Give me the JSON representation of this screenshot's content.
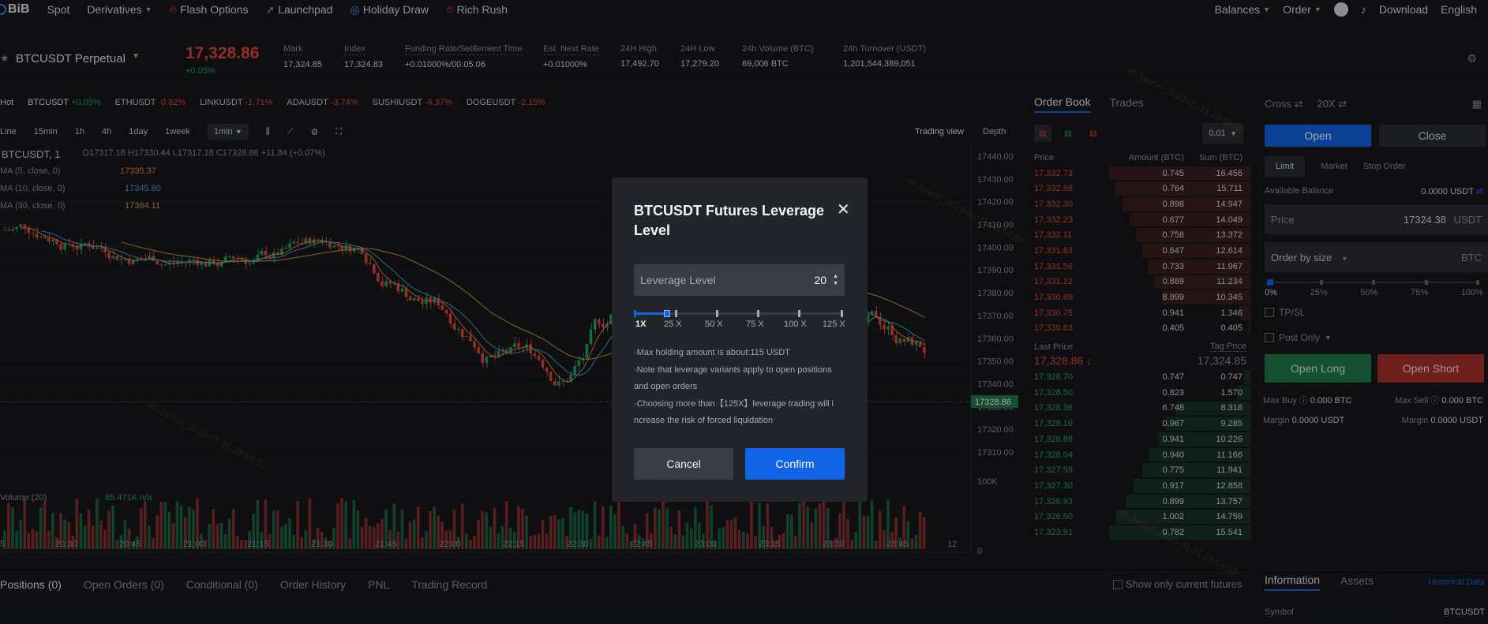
{
  "nav": {
    "logo": "BiB",
    "items": [
      {
        "label": "Spot"
      },
      {
        "label": "Derivatives"
      },
      {
        "label": "Flash Options"
      },
      {
        "label": "Launchpad"
      },
      {
        "label": "Holiday Draw"
      },
      {
        "label": "Rich Rush"
      }
    ],
    "right": {
      "balances": "Balances",
      "order": "Order",
      "download": "Download",
      "language": "English"
    }
  },
  "ticker": {
    "symbol": "BTCUSDT Perpetual",
    "price": "17,328.86",
    "change": "+0.05%",
    "stats": [
      {
        "label": "Mark",
        "value": "17,324.85"
      },
      {
        "label": "Index",
        "value": "17,324.83"
      },
      {
        "label": "Funding Rate/Settlement Time",
        "value": "+0.01000%/00:05:06"
      },
      {
        "label": "Est. Next Rate",
        "value": "+0.01000%"
      },
      {
        "label": "24H High",
        "value": "17,492.70"
      },
      {
        "label": "24H Low",
        "value": "17,279.20"
      },
      {
        "label": "24h Volume  (BTC)",
        "value": "69,006 BTC"
      },
      {
        "label": "24h Turnover  (USDT)",
        "value": "1,201,544,389,051"
      }
    ]
  },
  "mini_tickers": {
    "hot": "Hot",
    "items": [
      {
        "symbol": "BTCUSDT",
        "change": "+0.05%",
        "dir": "up"
      },
      {
        "symbol": "ETHUSDT",
        "change": "-0.82%",
        "dir": "dn"
      },
      {
        "symbol": "LINKUSDT",
        "change": "-1.71%",
        "dir": "dn"
      },
      {
        "symbol": "ADAUSDT",
        "change": "-3.74%",
        "dir": "dn"
      },
      {
        "symbol": "SUSHIUSDT",
        "change": "-6.37%",
        "dir": "dn"
      },
      {
        "symbol": "DOGEUSDT",
        "change": "-2.15%",
        "dir": "dn"
      }
    ]
  },
  "chart_toolbar": {
    "intervals": [
      "Line",
      "15min",
      "1h",
      "4h",
      "1day",
      "1week"
    ],
    "active_interval": "1min",
    "trading_view": "Trading view",
    "depth": "Depth"
  },
  "chart": {
    "legend_symbol": "BTCUSDT, 1",
    "ohlc": "O17317.18  H17330.44  L17317.18  C17328.86  +11.84 (+0.07%)",
    "ma5_label": "MA (5, close, 0)",
    "ma5_val": "17335.37",
    "ma10_label": "MA (10, close, 0)",
    "ma10_val": "17345.80",
    "ma30_label": "MA (30, close, 0)",
    "ma30_val": "17364.11",
    "volume_label": "Volume (20)",
    "volume_val": "85.471K  n/a",
    "price_ticks": [
      "17440.00",
      "17430.00",
      "17420.00",
      "17410.00",
      "17400.00",
      "17390.00",
      "17380.00",
      "17370.00",
      "17360.00",
      "17350.00",
      "17340.00",
      "17330.00",
      "17320.00",
      "17310.00"
    ],
    "current_price_tag": "17328.86",
    "vol_ticks": [
      "100K",
      "0"
    ],
    "time_ticks": [
      "5",
      "20:30",
      "20:45",
      "21:00",
      "21:15",
      "21:30",
      "21:45",
      "22:00",
      "22:15",
      "22:30",
      "22:45",
      "23:00",
      "23:15",
      "23:30",
      "23:45",
      "12"
    ]
  },
  "bottom_tabs": {
    "items": [
      "Positions (0)",
      "Open Orders (0)",
      "Conditional (0)",
      "Order History",
      "PNL",
      "Trading Record"
    ],
    "show_only": "Show only current futures"
  },
  "orderbook": {
    "tabs": [
      "Order Book",
      "Trades"
    ],
    "precision": "0.01",
    "headers": [
      "Price",
      "Amount (BTC)",
      "Sum (BTC)"
    ],
    "asks": [
      [
        "17,332.73",
        "0.745",
        "16.456"
      ],
      [
        "17,332.58",
        "0.764",
        "15.711"
      ],
      [
        "17,332.30",
        "0.898",
        "14.947"
      ],
      [
        "17,332.23",
        "0.677",
        "14.049"
      ],
      [
        "17,332.11",
        "0.758",
        "13.372"
      ],
      [
        "17,331.63",
        "0.647",
        "12.614"
      ],
      [
        "17,331.56",
        "0.733",
        "11.967"
      ],
      [
        "17,331.12",
        "0.889",
        "11.234"
      ],
      [
        "17,330.89",
        "8.999",
        "10.345"
      ],
      [
        "17,330.75",
        "0.941",
        "1.346"
      ],
      [
        "17,330.63",
        "0.405",
        "0.405"
      ]
    ],
    "last_price_label": "Last Price",
    "tag_price_label": "Tag Price",
    "last_price": "17,328.86 ↓",
    "tag_price": "17,324.85",
    "bids": [
      [
        "17,328.70",
        "0.747",
        "0.747"
      ],
      [
        "17,328.50",
        "0.823",
        "1.570"
      ],
      [
        "17,328.36",
        "6.748",
        "8.318"
      ],
      [
        "17,328.16",
        "0.967",
        "9.285"
      ],
      [
        "17,328.88",
        "0.941",
        "10.226"
      ],
      [
        "17,328.04",
        "0.940",
        "11.166"
      ],
      [
        "17,327.59",
        "0.775",
        "11.941"
      ],
      [
        "17,327.30",
        "0.917",
        "12.858"
      ],
      [
        "17,326.93",
        "0.899",
        "13.757"
      ],
      [
        "17,326.50",
        "1.002",
        "14.759"
      ],
      [
        "17,323.91",
        "0.782",
        "15.541"
      ]
    ]
  },
  "trade": {
    "margin_mode": "Cross",
    "leverage": "20X",
    "open": "Open",
    "close": "Close",
    "order_types": [
      "Limit",
      "Market",
      "Stop Order"
    ],
    "available_label": "Available Balance",
    "available_value": "0.0000 USDT",
    "price_label": "Price",
    "price_value": "17324.38",
    "price_unit": "USDT",
    "size_label": "Order by size",
    "size_unit": "BTC",
    "pcts": [
      "0%",
      "25%",
      "50%",
      "75%",
      "100%"
    ],
    "tpsl": "TP/SL",
    "post_only": "Post Only",
    "open_long": "Open Long",
    "open_short": "Open Short",
    "max_buy_label": "Max Buy",
    "max_buy": "0.000 BTC",
    "max_sell_label": "Max Sell",
    "max_sell": "0.000 BTC",
    "margin_label": "Margin",
    "margin_left": "0.0000 USDT",
    "margin_right": "0.0000 USDT",
    "info_tabs": [
      "Information",
      "Assets"
    ],
    "historical": "Historical Data",
    "symbol_label": "Symbol",
    "symbol_value": "BTCUSDT"
  },
  "modal": {
    "title": "BTCUSDT Futures Leverage Level",
    "leverage_label": "Leverage Level",
    "leverage_value": "20",
    "leverage_fraction": 0.16,
    "slider_labels": [
      "1X",
      "25 X",
      "50 X",
      "75 X",
      "100 X",
      "125 X"
    ],
    "notes": [
      "·Max holding amount is about:115 USDT",
      "·Note that leverage variants apply to open positions and open orders",
      "·Choosing more than【125X】leverage trading will i ncrease the risk of forced liquidation"
    ],
    "cancel": "Cancel",
    "confirm": "Confirm"
  },
  "colors": {
    "up": "#1fa564",
    "down": "#e2463c",
    "accent": "#1164e6",
    "ma5": "#e8843c",
    "ma10": "#38a9d9",
    "ma30": "#c9a23a"
  },
  "watermark": "ef-Janice_2023-01-11 23:54:53"
}
